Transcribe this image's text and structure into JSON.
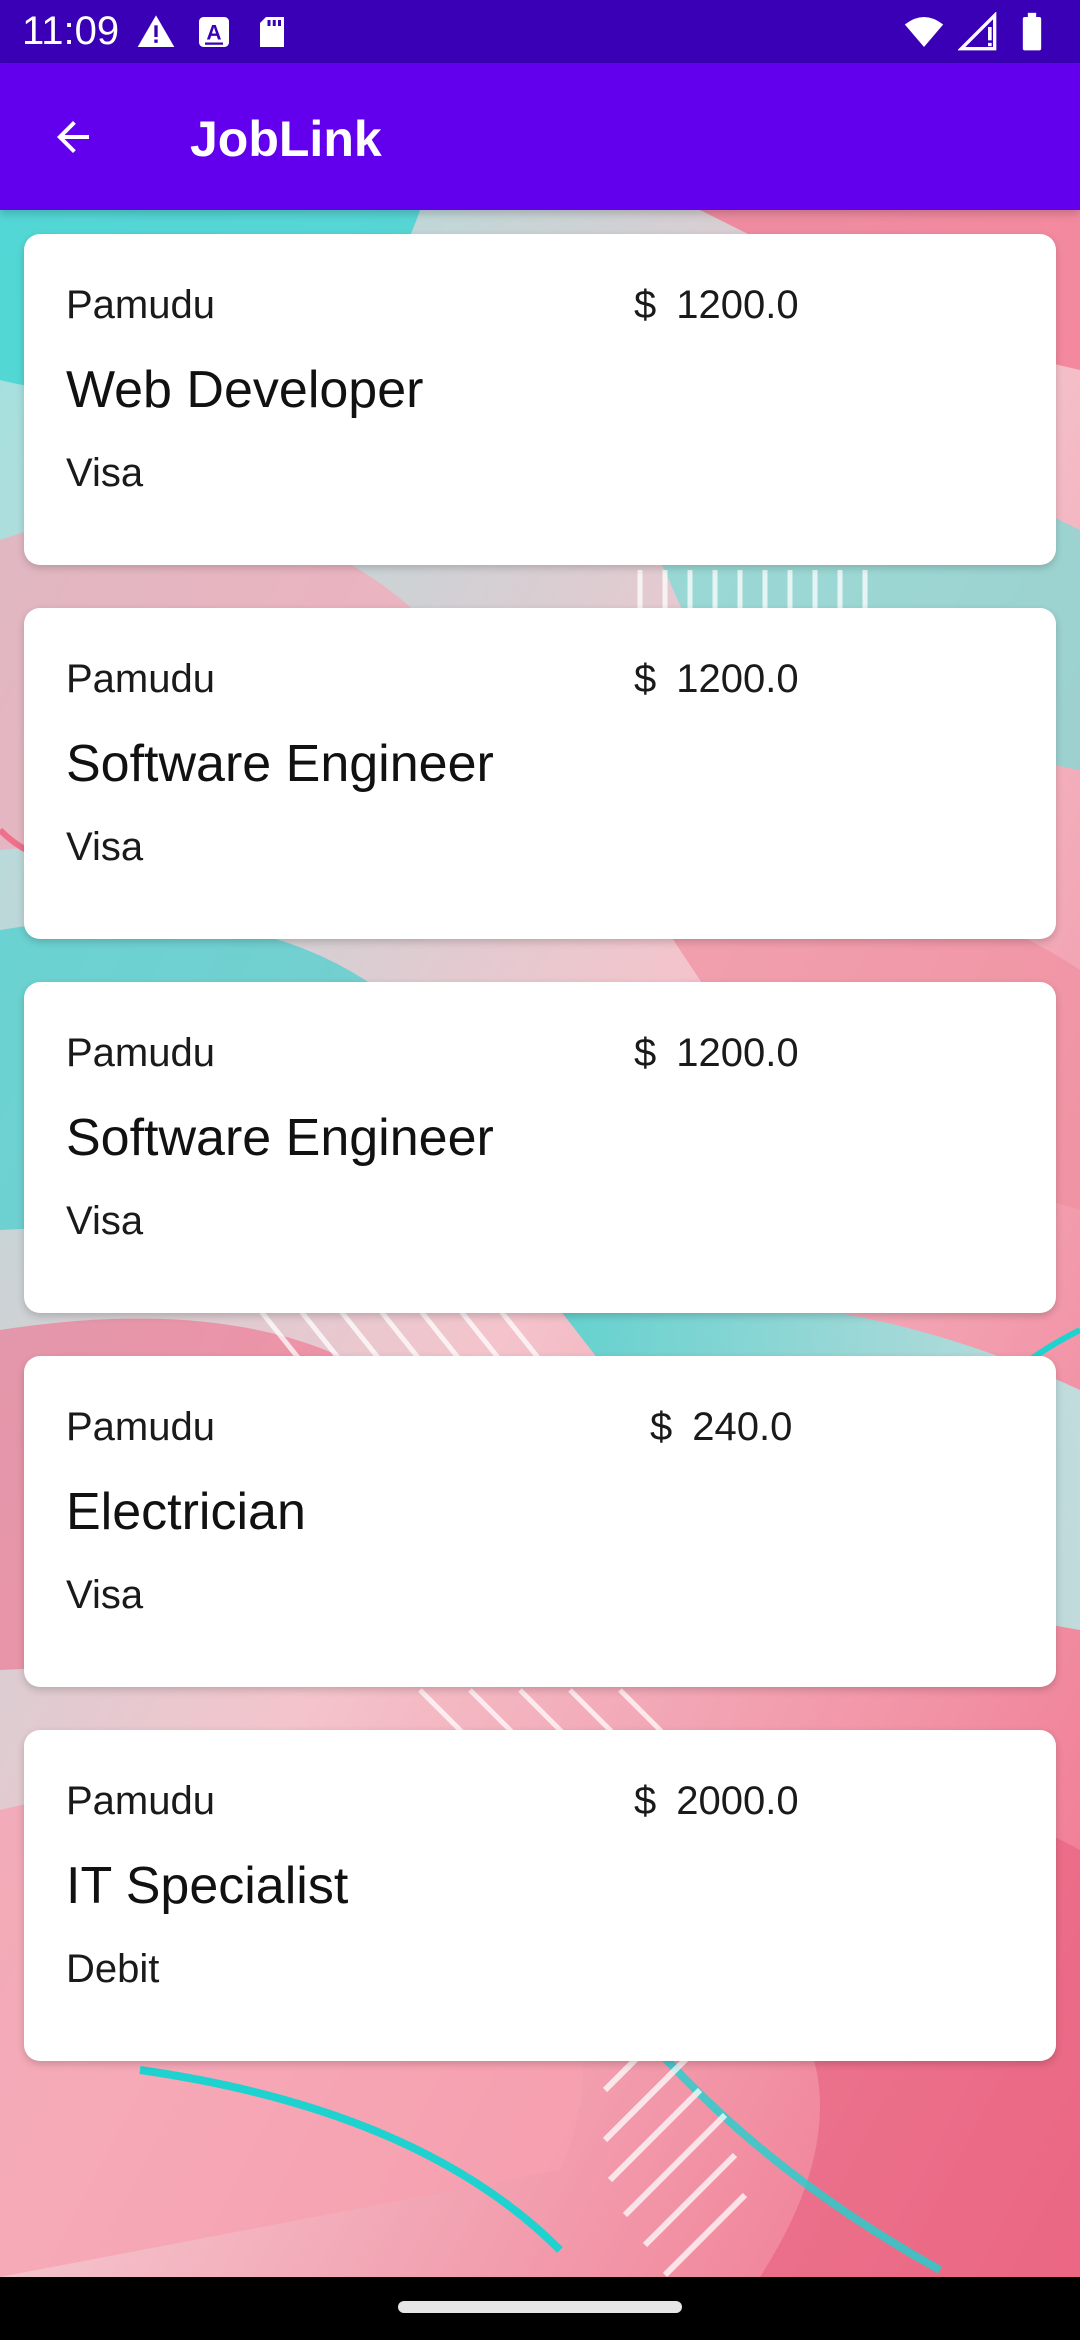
{
  "status_bar": {
    "time": "11:09",
    "left_icons": [
      "alert-icon",
      "a-notification-icon",
      "sd-card-icon"
    ],
    "right_icons": [
      "wifi-icon",
      "signal-icon",
      "battery-icon"
    ]
  },
  "app_bar": {
    "title": "JobLink",
    "back_icon": "arrow-back-icon"
  },
  "jobs": [
    {
      "owner": "Pamudu",
      "currency": "$",
      "amount": "1200.0",
      "title": "Web Developer",
      "payment": "Visa"
    },
    {
      "owner": "Pamudu",
      "currency": "$",
      "amount": "1200.0",
      "title": "Software Engineer",
      "payment": "Visa"
    },
    {
      "owner": "Pamudu",
      "currency": "$",
      "amount": "1200.0",
      "title": "Software Engineer",
      "payment": "Visa"
    },
    {
      "owner": "Pamudu",
      "currency": "$",
      "amount": "240.0",
      "title": "Electrician",
      "payment": "Visa"
    },
    {
      "owner": "Pamudu",
      "currency": "$",
      "amount": "2000.0",
      "title": "IT Specialist",
      "payment": "Debit"
    }
  ],
  "colors": {
    "status_bar": "#3a00b5",
    "app_bar": "#6200ee",
    "card": "#ffffff",
    "nav_bar": "#000000"
  }
}
